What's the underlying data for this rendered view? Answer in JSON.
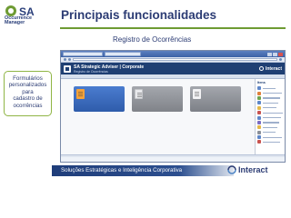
{
  "logo": {
    "mark": "SA",
    "subtitle_lines": [
      "Occurrence",
      "Manager"
    ],
    "icon": "sa-logo-icon",
    "colors": {
      "primary": "#2a3f7a",
      "accent": "#6e9b33"
    }
  },
  "slide": {
    "title": "Principais funcionalidades",
    "section": "Registro de Ocorrências",
    "callout_lines": [
      "Formulários",
      "personalizados para",
      "cadastro de",
      "ocorrências"
    ],
    "footer": "Soluções Estratégicas e Inteligência Corporativa",
    "footer_brand": "Interact",
    "footer_brand_mark": "®"
  },
  "window": {
    "app_title": "SA Strategic Adviser | Corporate",
    "app_subtitle": "Registro de Ocorrências",
    "brand": "Interact",
    "sidebar_heading": "Itens",
    "sidebar_items": [
      {
        "icon": "page-icon",
        "color": "#5d86c9"
      },
      {
        "icon": "chart-icon",
        "color": "#e0803c"
      },
      {
        "icon": "users-icon",
        "color": "#6da34d"
      },
      {
        "icon": "calendar-icon",
        "color": "#5d86c9"
      },
      {
        "icon": "folder-icon",
        "color": "#e4b847"
      },
      {
        "icon": "list-icon",
        "color": "#c9534f"
      },
      {
        "icon": "doc-icon",
        "color": "#5d86c9"
      },
      {
        "icon": "mail-icon",
        "color": "#7a6cc4"
      },
      {
        "icon": "star-icon",
        "color": "#e4b847"
      },
      {
        "icon": "gear-icon",
        "color": "#8a8f98"
      },
      {
        "icon": "help-icon",
        "color": "#5d86c9"
      },
      {
        "icon": "exit-icon",
        "color": "#c9534f"
      }
    ],
    "cards": [
      {
        "style": "blue",
        "icon": "form-icon",
        "title": ""
      },
      {
        "style": "grey1",
        "icon": "report-icon",
        "title": ""
      },
      {
        "style": "grey2",
        "icon": "document-icon",
        "title": ""
      }
    ]
  }
}
